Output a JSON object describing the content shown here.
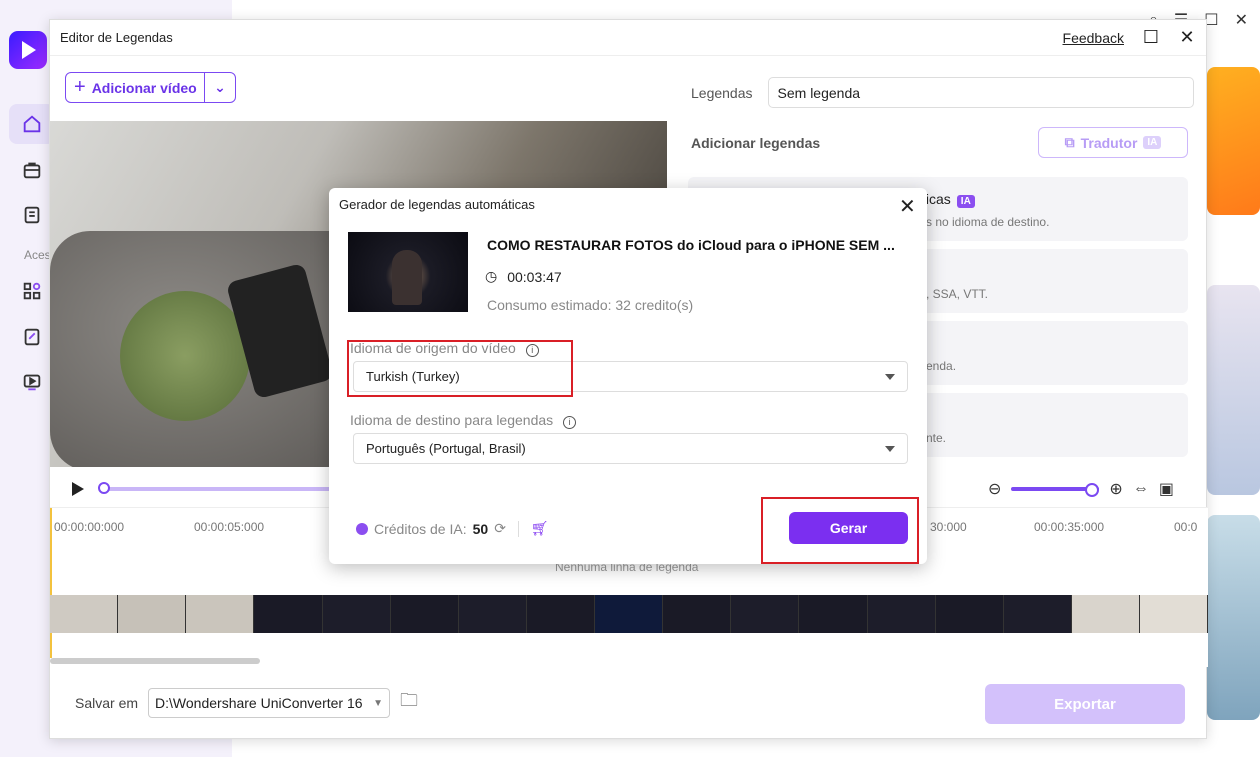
{
  "app": {
    "nav_section_label": "Aces"
  },
  "editor": {
    "title": "Editor de Legendas",
    "feedback": "Feedback",
    "add_video": "Adicionar vídeo",
    "timeline": {
      "ruler": [
        "00:00:00:000",
        "00:00:05:000",
        "30:000",
        "00:00:35:000",
        "00:0"
      ],
      "empty": "Nenhuma linha de legenda"
    },
    "save_label": "Salvar em",
    "save_path": "D:\\Wondershare UniConverter 16",
    "export": "Exportar"
  },
  "right_panel": {
    "legendas_label": "Legendas",
    "legendas_value": "Sem legenda",
    "add_label": "Adicionar legendas",
    "tradutor": "Tradutor",
    "ia_badge": "IA",
    "cards": [
      {
        "title": "ticas",
        "desc": "s no idioma de destino."
      },
      {
        "title": "",
        "desc": ", SSA, VTT."
      },
      {
        "title": "",
        "desc": "enda."
      },
      {
        "title": "",
        "desc": "nte."
      }
    ]
  },
  "dialog": {
    "title": "Gerador de legendas automáticas",
    "video_title": "COMO RESTAURAR FOTOS do iCloud para o iPHONE SEM ...",
    "duration": "00:03:47",
    "consumption": "Consumo estimado: 32 credito(s)",
    "source_label": "Idioma de origem do vídeo",
    "source_value": "Turkish (Turkey)",
    "target_label": "Idioma de destino para legendas",
    "target_value": "Português (Portugal, Brasil)",
    "credits_label": "Créditos de IA:",
    "credits_value": "50",
    "generate": "Gerar"
  },
  "colors": {
    "accent": "#7b2ff0",
    "highlight": "#d91f26"
  }
}
